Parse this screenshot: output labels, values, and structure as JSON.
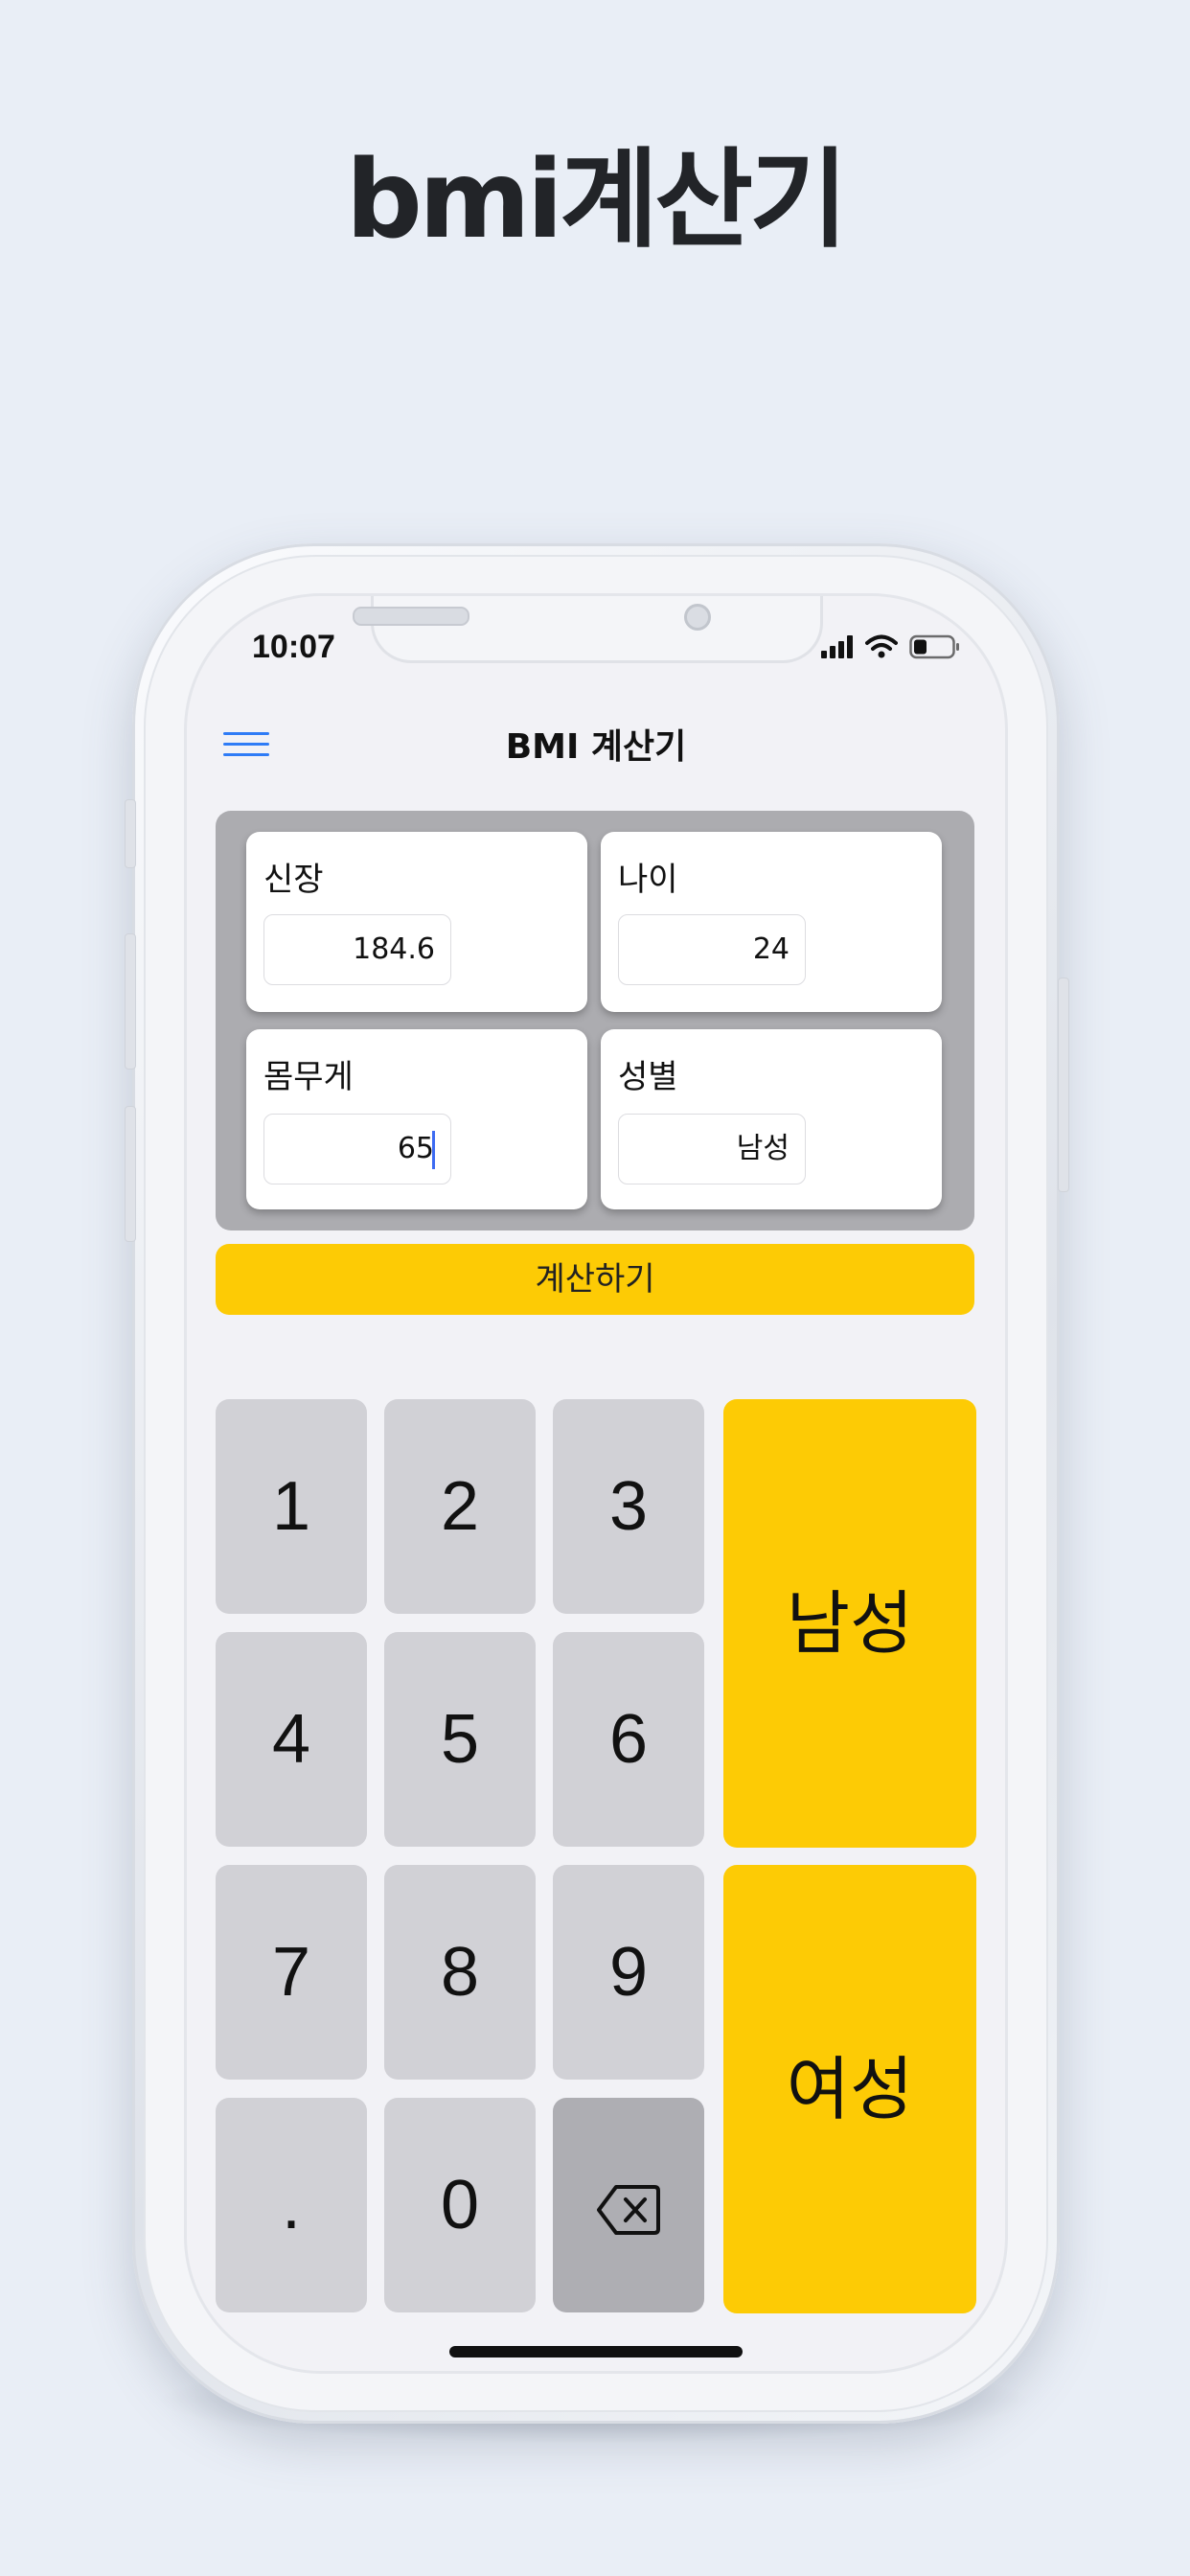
{
  "headline": "bmi계산기",
  "status_bar": {
    "time": "10:07"
  },
  "nav": {
    "title": "BMI 계산기",
    "menu_icon": "hamburger-menu-icon"
  },
  "fields": {
    "height": {
      "label": "신장",
      "value": "184.6"
    },
    "age": {
      "label": "나이",
      "value": "24"
    },
    "weight": {
      "label": "몸무게",
      "value": "65"
    },
    "gender": {
      "label": "성별",
      "value": "남성"
    }
  },
  "calculate_label": "계산하기",
  "keypad": {
    "k1": "1",
    "k2": "2",
    "k3": "3",
    "k4": "4",
    "k5": "5",
    "k6": "6",
    "k7": "7",
    "k8": "8",
    "k9": "9",
    "dot": ".",
    "k0": "0",
    "backspace_icon": "backspace-icon"
  },
  "gender_buttons": {
    "male": "남성",
    "female": "여성"
  },
  "colors": {
    "accent": "#fdcb05",
    "key": "#d1d1d6",
    "key_dark": "#aeaeb3",
    "panel": "#acacb0",
    "menu": "#2f7cf6"
  }
}
